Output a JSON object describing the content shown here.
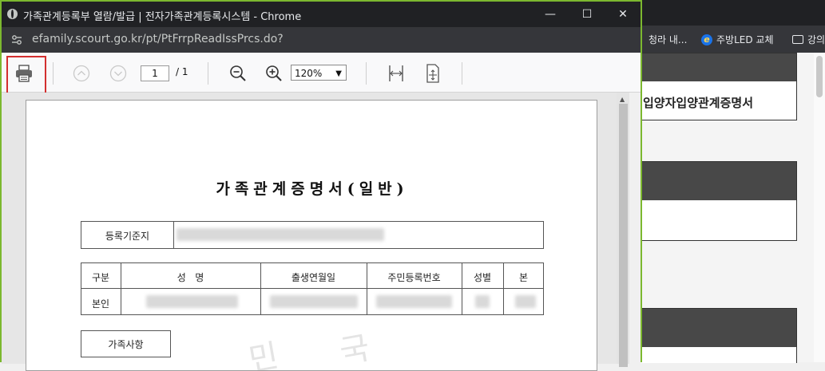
{
  "popup": {
    "window_title": "가족관계등록부 열람/발급 | 전자가족관계등록시스템 - Chrome",
    "url": "efamily.scourt.go.kr/pt/PtFrrpReadIssPrcs.do?",
    "window_controls": {
      "minimize": "—",
      "maximize": "☐",
      "close": "✕"
    }
  },
  "viewer": {
    "page_current": "1",
    "page_separator": "/ 1",
    "zoom": "120%"
  },
  "document": {
    "title": "가족관계증명서(일반)",
    "registration_label": "등록기준지",
    "table_headers": [
      "구분",
      "성   명",
      "출생연월일",
      "주민등록번호",
      "성별",
      "본"
    ],
    "self_row_label": "본인",
    "family_label": "가족사항",
    "watermark": [
      "민",
      "국"
    ]
  },
  "background": {
    "bookmarks": [
      {
        "label": "청라 내...",
        "icon": "none"
      },
      {
        "label": "주방LED 교체",
        "icon": "ie-icon"
      },
      {
        "label": "강의",
        "icon": "folder-icon"
      }
    ],
    "card_title": "입양자입양관계증명서"
  },
  "colors": {
    "window_border": "#7cb82f",
    "highlight_box": "#d32f2f",
    "dark_header": "#484848"
  }
}
